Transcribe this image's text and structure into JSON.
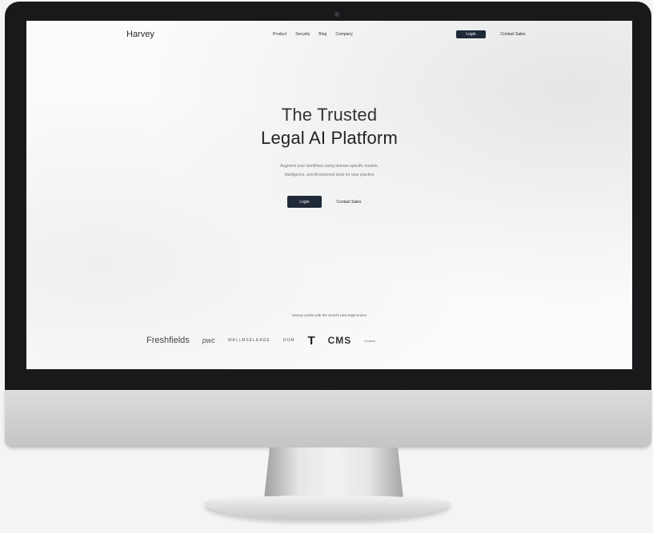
{
  "website": {
    "logo": "Harvey",
    "nav": {
      "links": [
        "Product",
        "Security",
        "Blog",
        "Company"
      ],
      "login": "Login",
      "contact": "Contact Sales"
    },
    "hero": {
      "title_line1": "The Trusted",
      "title_line2": "Legal AI Platform",
      "subtitle_line1": "Augment your workflows using domain-specific models,",
      "subtitle_line2": "intelligence, and AI-powered tools for your practice",
      "login_button": "Login",
      "contact_button": "Contact Sales"
    },
    "trusted_text": "Harvey works with the world's best legal teams",
    "client_logos": [
      "Freshfields",
      "pwc",
      "WALLMSELEAGE",
      "OUM",
      "T",
      "CMS",
      "Crowne"
    ]
  },
  "colors": {
    "button_dark": "#1f2937",
    "bezel": "#18191b",
    "page_bg": "#fbfbfb"
  }
}
